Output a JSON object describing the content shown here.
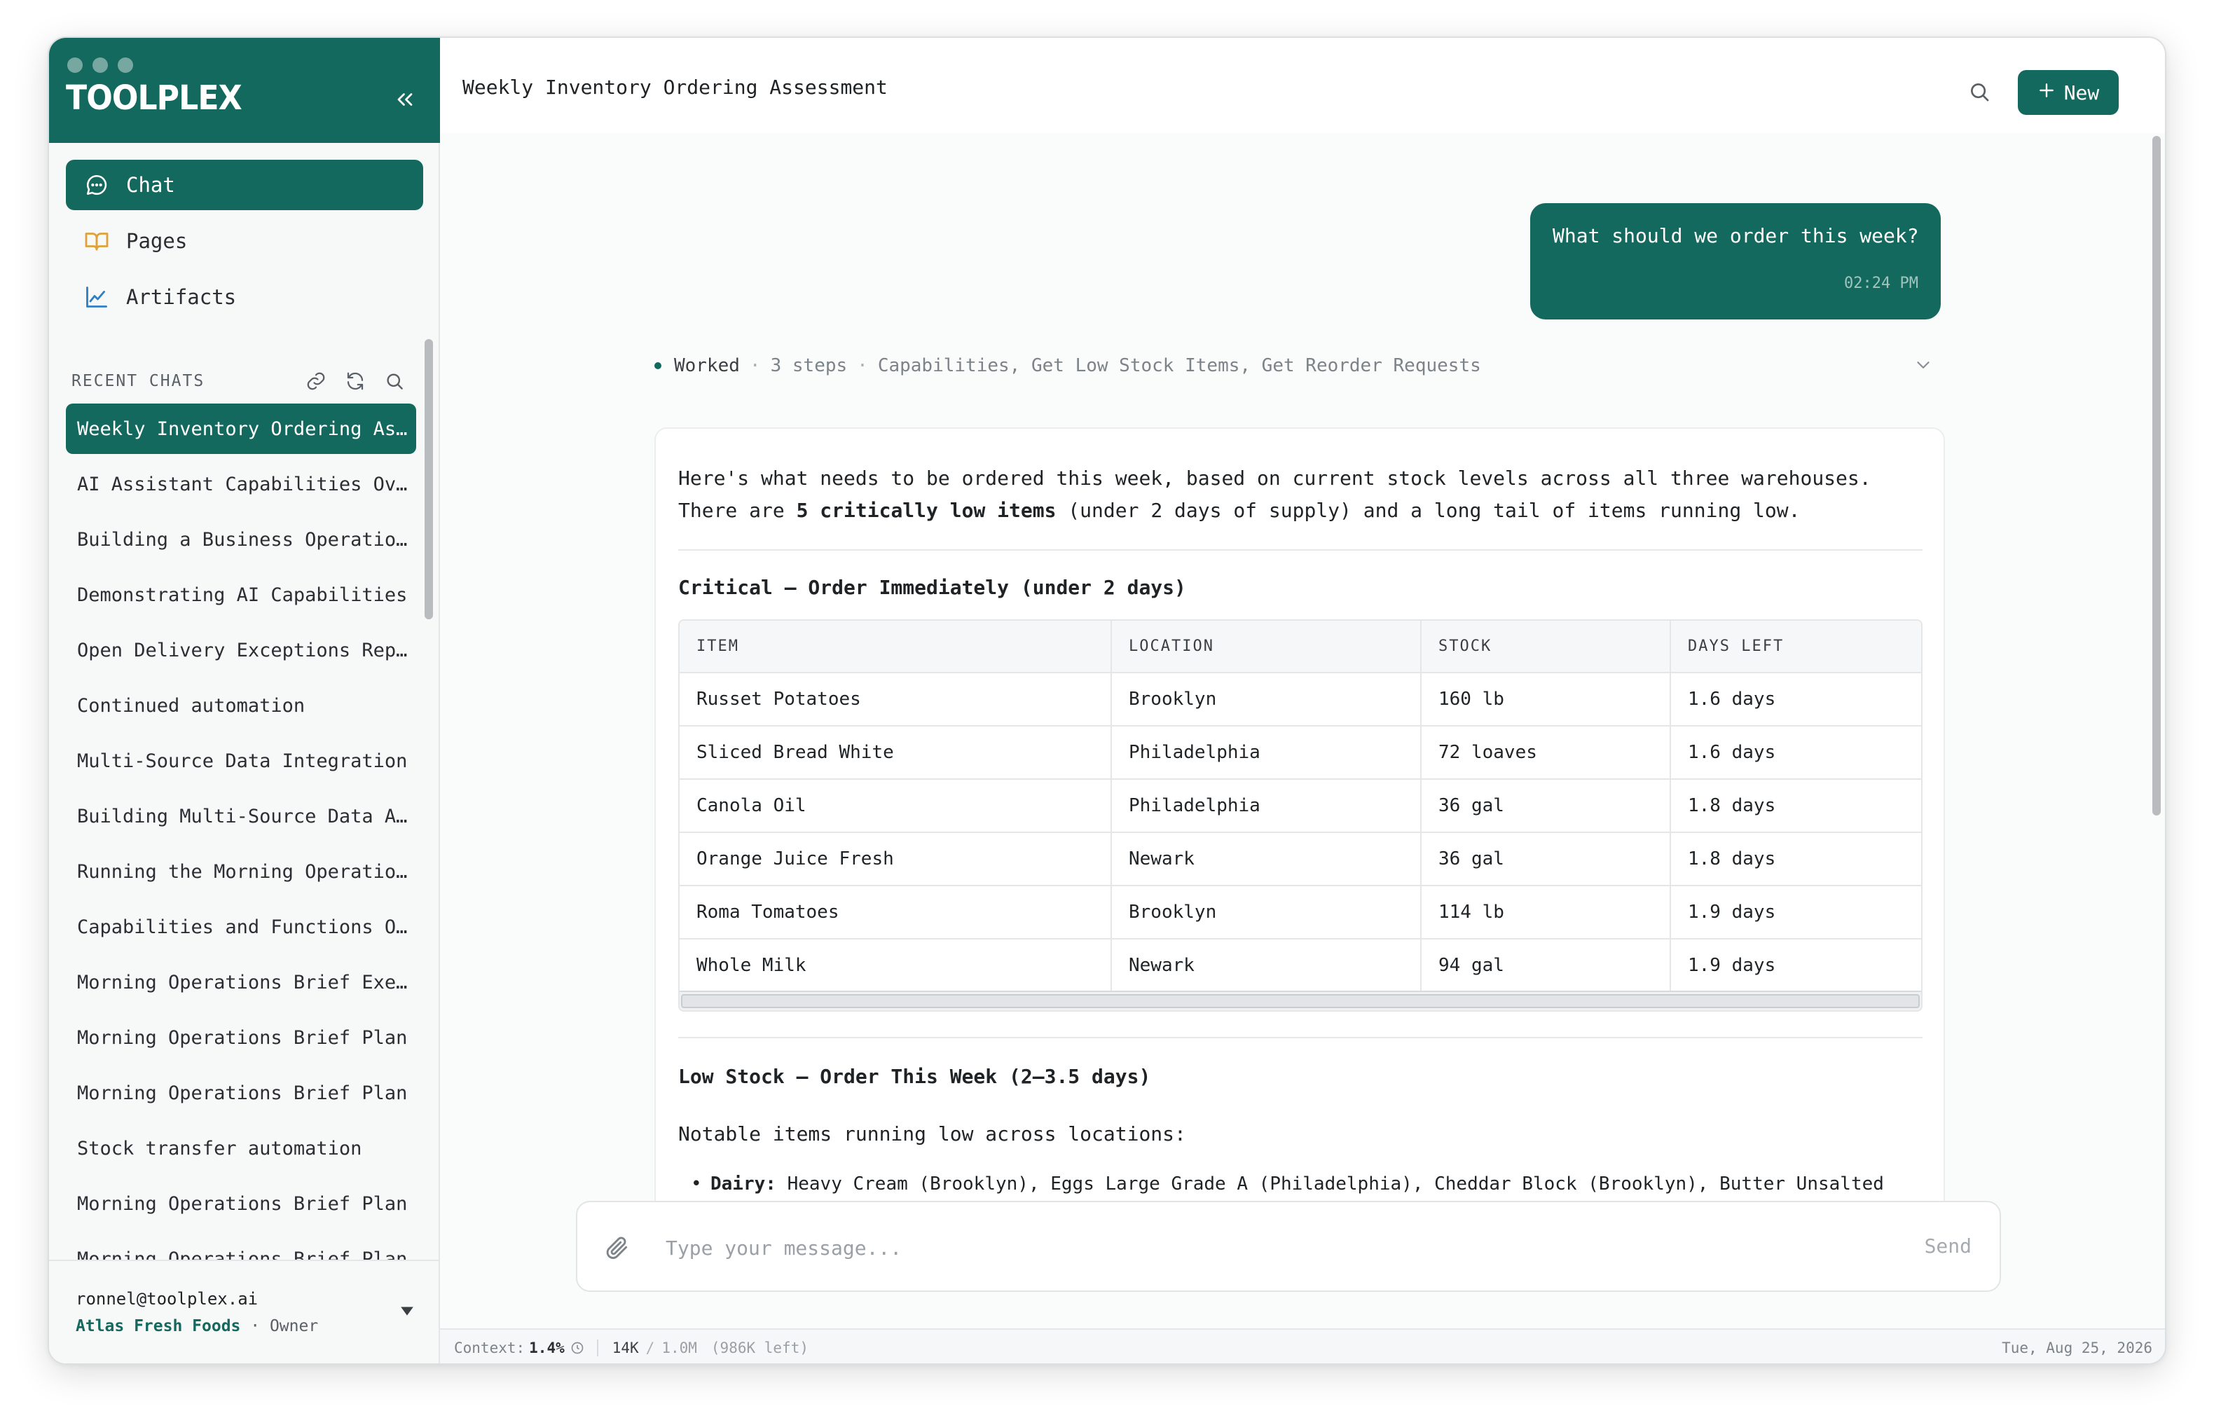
{
  "app": {
    "name": "TOOLPLEX"
  },
  "nav": [
    {
      "label": "Chat",
      "icon": "chat-bubble-icon",
      "active": true
    },
    {
      "label": "Pages",
      "icon": "book-icon",
      "active": false
    },
    {
      "label": "Artifacts",
      "icon": "line-chart-icon",
      "active": false
    }
  ],
  "recent": {
    "label": "RECENT CHATS",
    "chats": [
      "Weekly Inventory Ordering Assessment",
      "AI Assistant Capabilities Overview",
      "Building a Business Operations Dashboard",
      "Demonstrating AI Capabilities",
      "Open Delivery Exceptions Report",
      "Continued automation",
      "Multi-Source Data Integration",
      "Building Multi-Source Data Analysis",
      "Running the Morning Operations Brief",
      "Capabilities and Functions Overview",
      "Morning Operations Brief Execution",
      "Morning Operations Brief Plan",
      "Morning Operations Brief Plan",
      "Stock transfer automation",
      "Morning Operations Brief Plan",
      "Morning Operations Brief Plan"
    ]
  },
  "account": {
    "email": "ronnel@toolplex.ai",
    "org": "Atlas Fresh Foods",
    "role": "Owner"
  },
  "header": {
    "title": "Weekly Inventory Ordering Assessment",
    "new_label": "New"
  },
  "user_message": {
    "text": "What should we order this week?",
    "time": "02:24 PM"
  },
  "worked": {
    "label": "Worked",
    "steps": "3 steps",
    "tools": "Capabilities, Get Low Stock Items, Get Reorder Requests"
  },
  "assistant": {
    "intro_line1": "Here's what needs to be ordered this week, based on current stock levels across all three warehouses.",
    "intro_prefix": "There are ",
    "intro_bold": "5 critically low items",
    "intro_suffix": " (under 2 days of supply) and a long tail of items running low.",
    "critical_heading": "Critical — Order Immediately (under 2 days)",
    "table": {
      "headers": [
        "ITEM",
        "LOCATION",
        "STOCK",
        "DAYS LEFT"
      ],
      "rows": [
        [
          "Russet Potatoes",
          "Brooklyn",
          "160 lb",
          "1.6 days"
        ],
        [
          "Sliced Bread White",
          "Philadelphia",
          "72 loaves",
          "1.6 days"
        ],
        [
          "Canola Oil",
          "Philadelphia",
          "36 gal",
          "1.8 days"
        ],
        [
          "Orange Juice Fresh",
          "Newark",
          "36 gal",
          "1.8 days"
        ],
        [
          "Roma Tomatoes",
          "Brooklyn",
          "114 lb",
          "1.9 days"
        ],
        [
          "Whole Milk",
          "Newark",
          "94 gal",
          "1.9 days"
        ]
      ]
    },
    "low_heading": "Low Stock — Order This Week (2–3.5 days)",
    "notable": "Notable items running low across locations:",
    "bullet_label": "Dairy:",
    "bullet_text": " Heavy Cream (Brooklyn), Eggs Large Grade A (Philadelphia), Cheddar Block (Brooklyn), Butter Unsalted (Brooklyn), Ricotta (Brooklyn)"
  },
  "composer": {
    "placeholder": "Type your message...",
    "send_label": "Send"
  },
  "status": {
    "context_label": "Context:",
    "context_value": "1.4%",
    "tokens": "14K",
    "limit": "1.0M",
    "left": "(986K left)",
    "date": "Tue, Aug 25, 2026"
  },
  "colors": {
    "brand": "#14695e",
    "pages_icon": "#e0a13a",
    "artifacts_icon": "#2f7fc4"
  }
}
